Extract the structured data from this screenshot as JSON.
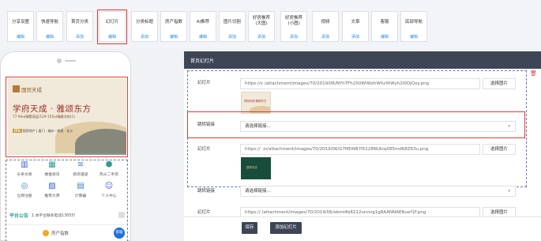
{
  "toolbar": {
    "items": [
      {
        "line1": "分享设置",
        "line2": "",
        "sub": "编辑"
      },
      {
        "line1": "快速导航",
        "line2": "",
        "sub": "编辑"
      },
      {
        "line1": "首页分类",
        "line2": "",
        "sub": "添加"
      },
      {
        "line1": "幻灯片",
        "line2": "",
        "sub": "编辑"
      },
      {
        "line1": "分类标题",
        "line2": "",
        "sub": "添加"
      },
      {
        "line1": "房产指数",
        "line2": "",
        "sub": "编辑"
      },
      {
        "line1": "AI推荐",
        "line2": "",
        "sub": "编辑"
      },
      {
        "line1": "图片切割",
        "line2": "",
        "sub": "添加"
      },
      {
        "line1": "好房推荐",
        "line2": "(大图)",
        "sub": "添加"
      },
      {
        "line1": "好房推荐",
        "line2": "(小图)",
        "sub": "添加"
      },
      {
        "line1": "视频",
        "line2": "",
        "sub": "添加"
      },
      {
        "line1": "文章",
        "line2": "",
        "sub": "添加"
      },
      {
        "line1": "客服",
        "line2": "",
        "sub": "编辑"
      },
      {
        "line1": "底部导航",
        "line2": "",
        "sub": "编辑"
      }
    ]
  },
  "phone": {
    "banner": {
      "logo_text": "国贸天成",
      "headline": "学府天成 · 雅颂东方",
      "subline": "77-94㎡臻墅高层/129-155㎡臻藏洋房(1)",
      "footer_badge": "ITG",
      "footer_text": "国贸地产 | 厦门 · 福州 · 南昌 · 长沙"
    },
    "icons": [
      {
        "name": "headline-news-icon",
        "glyph": "▥",
        "color": "#3b5bdb",
        "label": "头条文章"
      },
      {
        "name": "building-info-icon",
        "glyph": "▦",
        "color": "#2a9d8f",
        "label": "楼盘资讯"
      },
      {
        "name": "new-house-icon",
        "glyph": "≋",
        "color": "#3b82c4",
        "label": "新房速递"
      },
      {
        "name": "hot-second-hand-icon",
        "glyph": "⬢",
        "color": "#2a9d8f",
        "label": "热火二手房"
      },
      {
        "name": "register-icon",
        "glyph": "◎",
        "color": "#3b82c4",
        "label": "立即注册"
      },
      {
        "name": "recommend-icon",
        "glyph": "▨",
        "color": "#3b5bdb",
        "label": "推荐大师"
      },
      {
        "name": "calculator-icon",
        "glyph": "▤",
        "color": "#3b82c4",
        "label": "计算器"
      },
      {
        "name": "user-center-icon",
        "glyph": "☺",
        "color": "#3b5bdb",
        "label": "个人中心"
      }
    ],
    "notice_title": "平台公告",
    "notice_text": "1.本平台联系电话13055!",
    "price_label": "房产指数",
    "service_label": "客服"
  },
  "panel": {
    "header": "首页幻灯片",
    "slides": [
      {
        "image_label": "幻灯片",
        "image_path": "https://x          /attachment/images/70/2019/06/NYhTFh2X0WIWzhWhzXtWyh2I0OjOoy.png",
        "pick_label": "选择图片",
        "link_label": "跳转链接",
        "link_placeholder": "请选择链接...",
        "thumb_text": "学府天成·雅颂东方"
      },
      {
        "image_label": "幻灯片",
        "image_path": "https://          .in/attachment/images/70/2019/06/G7MDN87I5228NUkiqX85md68Z63u.png",
        "pick_label": "选择图片",
        "link_label": "跳转链接",
        "link_placeholder": "请选择链接...",
        "thumb_text": "国贸天成"
      },
      {
        "image_label": "幻灯片",
        "image_path": "https://          /attachment/images/70/2019/06/ebmI4b8212unnng1g8AANNAENuef1F.png",
        "pick_label": "选择图片"
      }
    ],
    "delete_glyph": "🗑",
    "dropdown_glyph": "▾",
    "save_label": "保存",
    "add_slide_label": "添加幻灯片"
  }
}
